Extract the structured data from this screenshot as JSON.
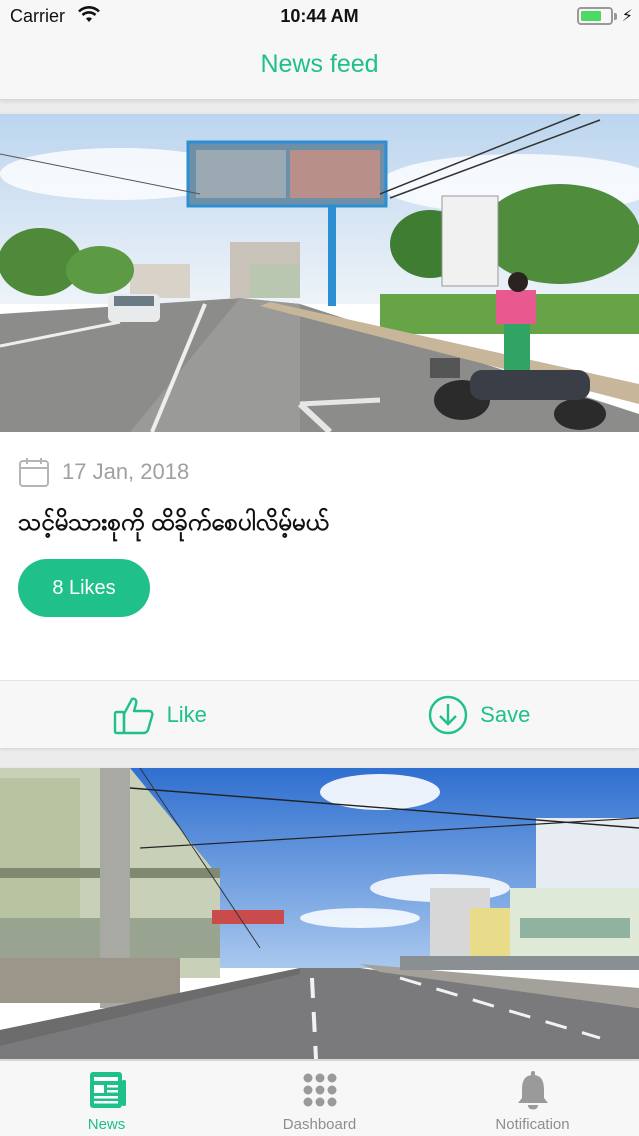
{
  "status_bar": {
    "carrier": "Carrier",
    "time": "10:44 AM"
  },
  "nav": {
    "title": "News feed"
  },
  "feed": {
    "items": [
      {
        "date": "17 Jan, 2018",
        "headline": "သင့်မိသားစုကို ထိခိုက်စေပါလိမ့်မယ်",
        "likes_label": "8 Likes",
        "image": "street-with-billboard-photo"
      },
      {
        "image": "wide-street-with-buildings-photo"
      }
    ],
    "actions": {
      "like_label": "Like",
      "save_label": "Save"
    }
  },
  "tabs": [
    {
      "label": "News",
      "icon": "newspaper-icon",
      "active": true
    },
    {
      "label": "Dashboard",
      "icon": "grid-icon",
      "active": false
    },
    {
      "label": "Notification",
      "icon": "bell-icon",
      "active": false
    }
  ],
  "colors": {
    "accent": "#1fc08a",
    "inactive": "#8e8e8e",
    "background": "#ececec"
  }
}
